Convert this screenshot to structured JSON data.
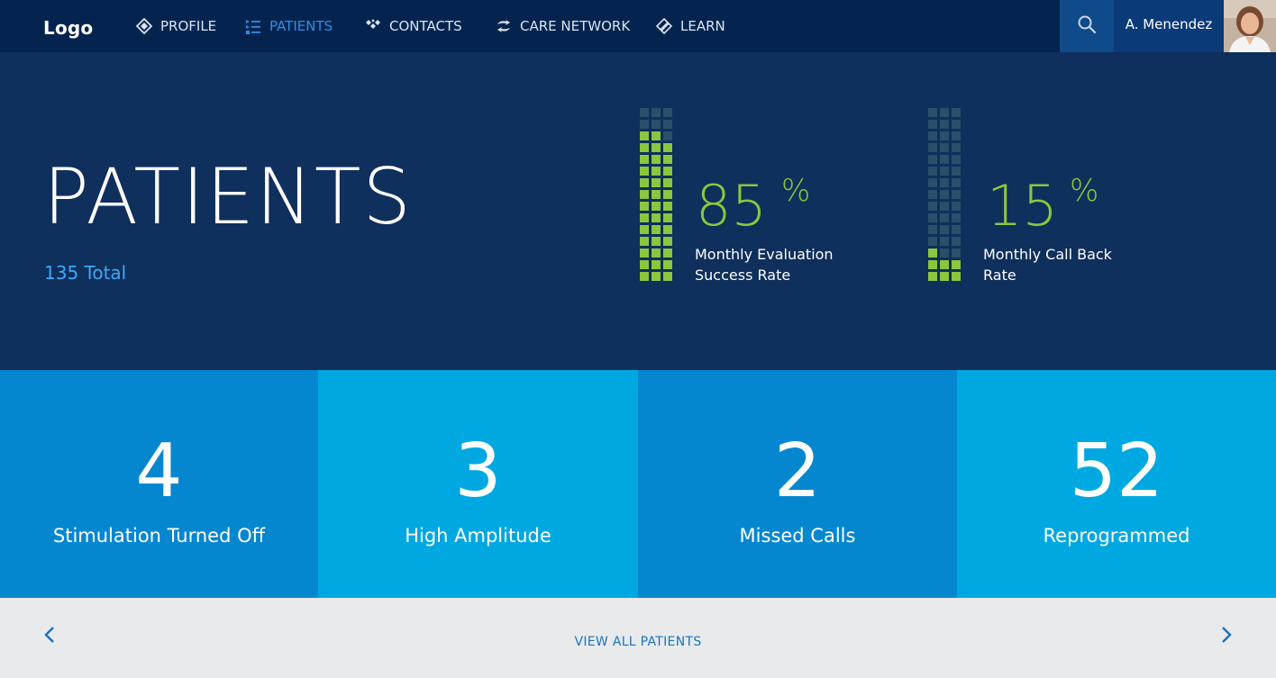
{
  "brand": {
    "logo": "Logo"
  },
  "nav": {
    "items": [
      {
        "label": "PROFILE",
        "icon": "diamond-icon",
        "active": false
      },
      {
        "label": "PATIENTS",
        "icon": "list-icon",
        "active": true
      },
      {
        "label": "CONTACTS",
        "icon": "contacts-icon",
        "active": false
      },
      {
        "label": "CARE NETWORK",
        "icon": "exchange-icon",
        "active": false
      },
      {
        "label": "LEARN",
        "icon": "learn-icon",
        "active": false
      }
    ],
    "search_icon": "search-icon",
    "user_name": "A. Menendez"
  },
  "hero": {
    "title": "PATIENTS",
    "total": "135 Total",
    "metrics": [
      {
        "value": "85",
        "unit": "%",
        "label": "Monthly Evaluation Success Rate",
        "fill_fraction": 0.85
      },
      {
        "value": "15",
        "unit": "%",
        "label": "Monthly Call Back Rate",
        "fill_fraction": 0.15
      }
    ]
  },
  "tiles": [
    {
      "number": "4",
      "label": "Stimulation Turned Off",
      "color": "#0587d0"
    },
    {
      "number": "3",
      "label": "High Amplitude",
      "color": "#00a8e1"
    },
    {
      "number": "2",
      "label": "Missed Calls",
      "color": "#0587d0"
    },
    {
      "number": "52",
      "label": "Reprogrammed",
      "color": "#00a8e1"
    }
  ],
  "footer": {
    "view_all": "VIEW ALL PATIENTS",
    "prev_icon": "chevron-left-icon",
    "next_icon": "chevron-right-icon"
  },
  "colors": {
    "nav_bg": "#04244f",
    "hero_bg": "#0f2f5c",
    "accent_green": "#8cc63f",
    "accent_blue": "#3fa9f5",
    "active_nav": "#2e8ee8",
    "footer_bg": "#e8eaeb"
  }
}
